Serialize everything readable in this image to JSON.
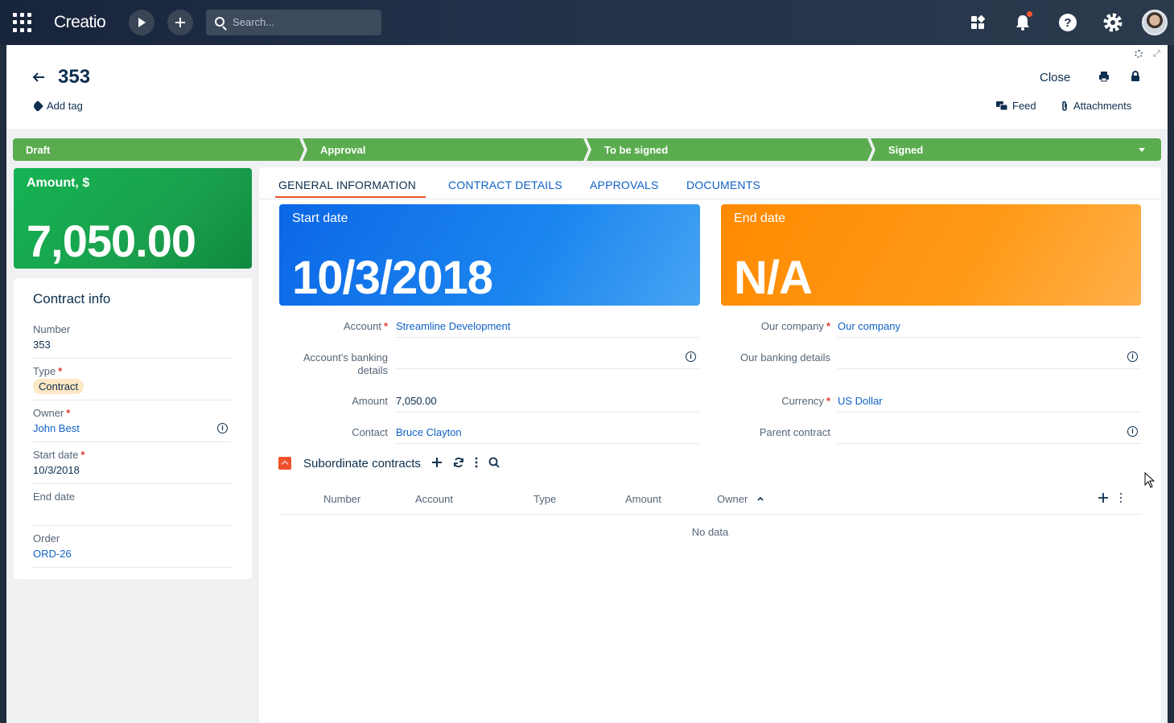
{
  "topbar": {
    "logo": "Creatio",
    "search_placeholder": "Search..."
  },
  "header": {
    "title": "353",
    "add_tag": "Add tag",
    "close_label": "Close",
    "feed_label": "Feed",
    "attachments_label": "Attachments"
  },
  "stages": [
    {
      "label": "Draft"
    },
    {
      "label": "Approval"
    },
    {
      "label": "To be signed"
    },
    {
      "label": "Signed"
    }
  ],
  "amount_card": {
    "label": "Amount, $",
    "value": "7,050.00"
  },
  "contract_info": {
    "title": "Contract info",
    "fields": [
      {
        "label": "Number",
        "value": "353"
      },
      {
        "label": "Type",
        "value": "Contract"
      },
      {
        "label": "Owner",
        "value": "John Best"
      },
      {
        "label": "Start date",
        "value": "10/3/2018"
      },
      {
        "label": "End date",
        "value": ""
      },
      {
        "label": "Order",
        "value": "ORD-26"
      }
    ]
  },
  "tabs": [
    {
      "label": "GENERAL INFORMATION"
    },
    {
      "label": "CONTRACT DETAILS"
    },
    {
      "label": "APPROVALS"
    },
    {
      "label": "DOCUMENTS"
    }
  ],
  "kpis": {
    "start": {
      "label": "Start date",
      "value": "10/3/2018"
    },
    "end": {
      "label": "End date",
      "value": "N/A"
    }
  },
  "form": {
    "account_label": "Account",
    "account_value": "Streamline Development",
    "account_banking_label_1": "Account's banking",
    "account_banking_label_2": "details",
    "amount_label": "Amount",
    "amount_value": "7,050.00",
    "contact_label": "Contact",
    "contact_value": "Bruce Clayton",
    "our_company_label": "Our company",
    "our_company_value": "Our company",
    "our_banking_label": "Our banking details",
    "currency_label": "Currency",
    "currency_value": "US Dollar",
    "parent_contract_label": "Parent contract"
  },
  "subordinate": {
    "title": "Subordinate contracts",
    "columns": [
      "Number",
      "Account",
      "Type",
      "Amount",
      "Owner"
    ],
    "empty_text": "No data"
  },
  "colors": {
    "stage_green": "#5aac4e",
    "amount_green": "#14b352",
    "kpi_blue": "#0b67e6",
    "kpi_orange": "#ff8a00",
    "link_blue": "#0f61c6",
    "required_red": "#e23b2f",
    "accent_orange": "#e2542e"
  },
  "icons": [
    "apps-grid-icon",
    "play-icon",
    "plus-icon",
    "search-icon",
    "dashboard-icon",
    "bell-icon",
    "help-icon",
    "gear-icon",
    "back-arrow-icon",
    "tag-icon",
    "print-icon",
    "lock-icon",
    "feed-icon",
    "paperclip-icon",
    "info-icon",
    "refresh-icon",
    "more-icon",
    "chevron-down-icon",
    "sort-asc-icon"
  ]
}
